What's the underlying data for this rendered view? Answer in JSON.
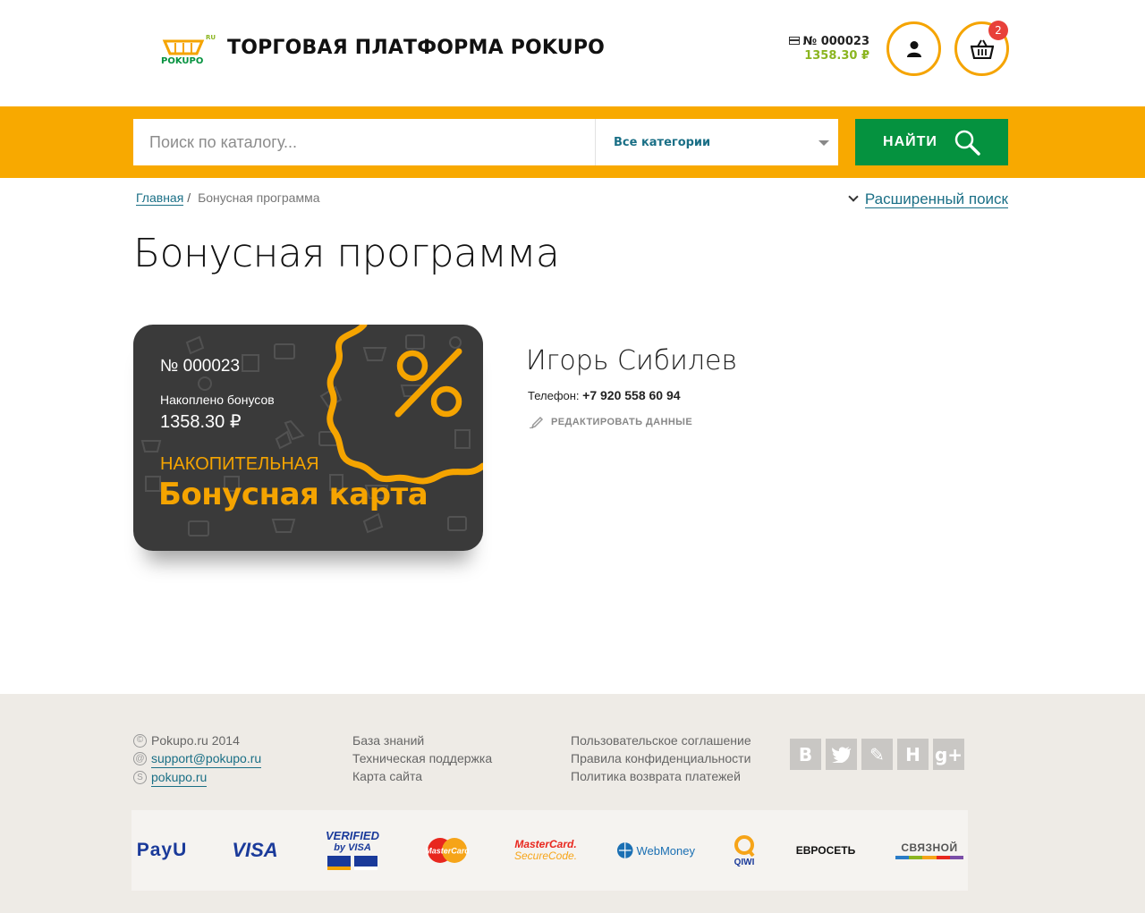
{
  "header": {
    "site_title": "ТОРГОВАЯ ПЛАТФОРМА POKUPO",
    "logo_text": "POKUPO",
    "logo_suffix": "RU",
    "bonus_number": "№ 000023",
    "bonus_amount": "1358.30 ₽",
    "cart_count": "2"
  },
  "search": {
    "placeholder": "Поиск по каталогу...",
    "category": "Все категории",
    "button_label": "НАЙТИ"
  },
  "breadcrumb": {
    "home": "Главная",
    "separator": "/",
    "current": "Бонусная программа"
  },
  "advanced_search": "Расширенный поиск",
  "page_title": "Бонусная программа",
  "card": {
    "number": "№ 000023",
    "accum_label": "Накоплено бонусов",
    "accum_value": "1358.30 ₽",
    "kind": "НАКОПИТЕЛЬНАЯ",
    "name": "Бонусная карта"
  },
  "profile": {
    "name": "Игорь Сибилев",
    "phone_label": "Телефон:",
    "phone_value": "+7 920 558 60 94",
    "edit_label": "РЕДАКТИРОВАТЬ ДАННЫЕ"
  },
  "footer": {
    "copyright": "Pokupo.ru 2014",
    "email": "support@pokupo.ru",
    "skype": "pokupo.ru",
    "col2": [
      "База знаний",
      "Техническая поддержка",
      "Карта сайта"
    ],
    "col3": [
      "Пользовательское соглашение",
      "Правила конфиденциальности",
      "Политика возврата платежей"
    ],
    "socials": [
      "В",
      "t",
      "✎",
      "H",
      "g+"
    ],
    "payments": {
      "payu": "PayU",
      "visa": "VISA",
      "verified_top": "VERIFIED",
      "verified_by": "by VISA",
      "mastercard": "MasterCard",
      "securecode_1": "MasterCard.",
      "securecode_2": "SecureCode.",
      "webmoney": "WebMoney",
      "qiwi": "QIWI",
      "euroset": "ЕВРОСЕТЬ",
      "svyaznoy": "СВЯЗНОЙ"
    }
  },
  "colors": {
    "accent_orange": "#f8a900",
    "search_button_green": "#05923f",
    "link_teal": "#1a6f86",
    "bonus_green": "#8bb520",
    "badge_red": "#e8403a",
    "card_dark": "#3a3a3a"
  }
}
